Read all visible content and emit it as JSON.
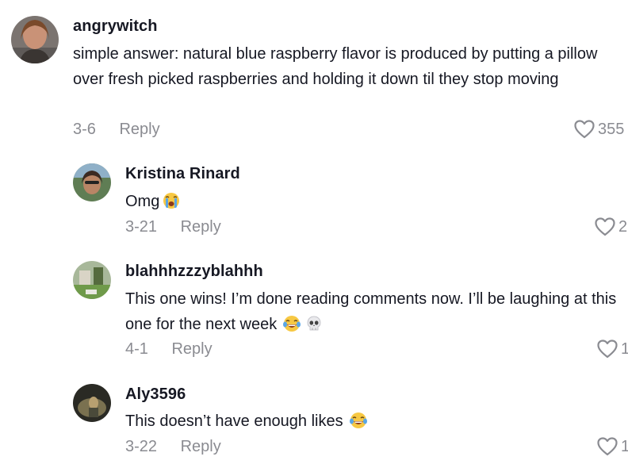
{
  "comments": [
    {
      "username": "angrywitch",
      "text": "simple answer: natural blue raspberry flavor is produced by putting a pillow over fresh picked raspberries and holding it down til they stop moving",
      "date": "3-6",
      "reply_label": "Reply",
      "likes": "355",
      "emojis": []
    },
    {
      "username": "Kristina Rinard",
      "text": "Omg",
      "date": "3-21",
      "reply_label": "Reply",
      "likes": "2",
      "emojis": [
        "loudly-crying-face"
      ]
    },
    {
      "username": "blahhhzzzyblahhh",
      "text": "This one wins! I’m done reading comments now. I’ll be laughing at this one for the next week",
      "date": "4-1",
      "reply_label": "Reply",
      "likes": "1",
      "emojis": [
        "face-with-tears-of-joy",
        "skull"
      ]
    },
    {
      "username": "Aly3596",
      "text": "This doesn’t have enough likes",
      "date": "3-22",
      "reply_label": "Reply",
      "likes": "1",
      "emojis": [
        "face-with-tears-of-joy"
      ]
    }
  ],
  "colors": {
    "text": "#161823",
    "muted": "#8a8b91",
    "background": "#ffffff"
  }
}
